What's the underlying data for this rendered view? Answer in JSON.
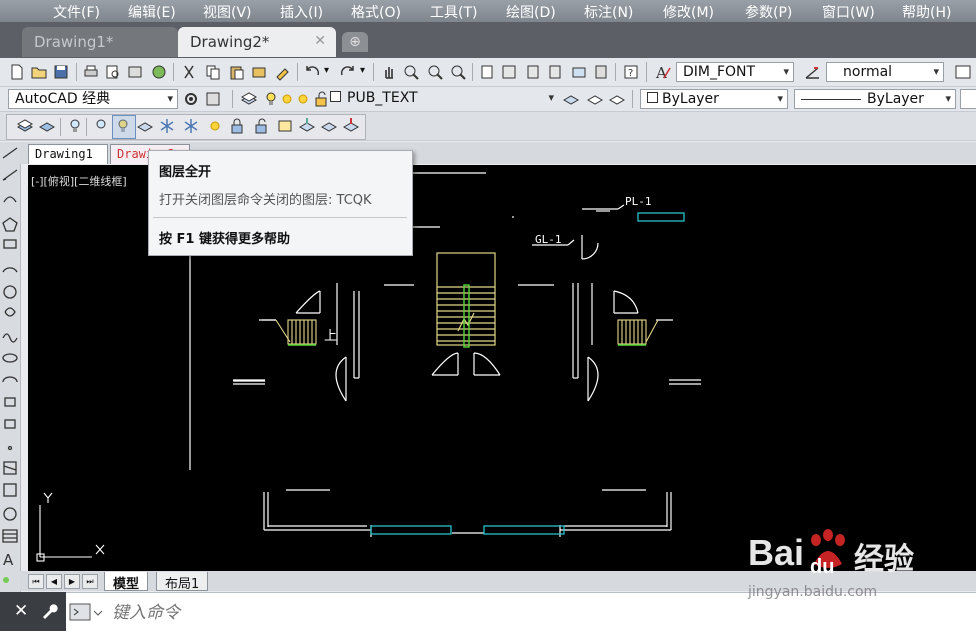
{
  "menubar": {
    "items": [
      "文件(F)",
      "编辑(E)",
      "视图(V)",
      "插入(I)",
      "格式(O)",
      "工具(T)",
      "绘图(D)",
      "标注(N)",
      "修改(M)",
      "参数(P)",
      "窗口(W)",
      "帮助(H)"
    ]
  },
  "file_tabs": [
    {
      "label": "Drawing1*",
      "active": false
    },
    {
      "label": "Drawing2*",
      "active": true
    }
  ],
  "toolbar1": {
    "text_style": "DIM_FONT",
    "dim_style": "normal"
  },
  "toolbar2": {
    "workspace": "AutoCAD 经典",
    "layer": "PUB_TEXT",
    "color": "ByLayer",
    "linetype": "ByLayer"
  },
  "drawing_tabs": [
    "Drawing1",
    "Drawing2"
  ],
  "viewport": {
    "label": "[-][俯视][二维线框]"
  },
  "drawing_labels": {
    "pl": "PL-1",
    "gl": "GL-1",
    "up": "上"
  },
  "layout_tabs": {
    "model": "模型",
    "layout1": "布局1"
  },
  "command": {
    "placeholder": "键入命令"
  },
  "tooltip": {
    "title": "图层全开",
    "description": "打开关闭图层命令关闭的图层: TCQK",
    "help": "按 F1 键获得更多帮助"
  },
  "watermark": {
    "brand_a": "Bai",
    "brand_b": "du",
    "brand_c": "经验",
    "url": "jingyan.baidu.com"
  },
  "colors": {
    "canvas": "#000000",
    "accent_cyan": "#27c3c9",
    "stair_yellow": "#e2d98a",
    "stair_green": "#59d63b"
  },
  "icons": {
    "close": "close-icon",
    "wrench": "wrench-icon",
    "prompt": "command-prompt-icon"
  }
}
